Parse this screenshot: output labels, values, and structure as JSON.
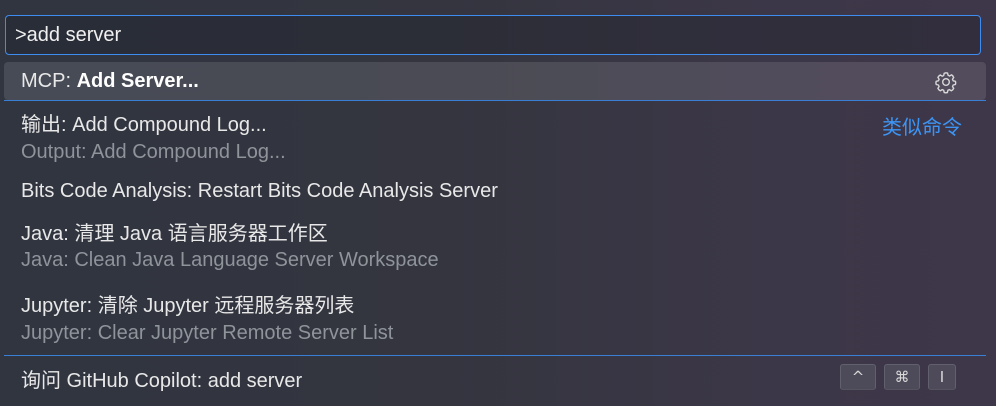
{
  "input": {
    "value": ">add server"
  },
  "items": [
    {
      "prefix": "MCP: ",
      "highlight": "Add Server...",
      "action": "gear-icon"
    },
    {
      "label": "输出: Add Compound Log...",
      "detail": "Output: Add Compound Log...",
      "tag": "类似命令"
    },
    {
      "label": "Bits Code Analysis: Restart Bits Code Analysis Server"
    },
    {
      "label": "Java: 清理 Java 语言服务器工作区",
      "detail": "Java: Clean Java Language Server Workspace"
    },
    {
      "label": "Jupyter: 清除 Jupyter 远程服务器列表",
      "detail": "Jupyter: Clear Jupyter Remote Server List"
    }
  ],
  "copilot": {
    "label": "询问 GitHub Copilot: add server",
    "keys": [
      "^",
      "⌘",
      "I"
    ]
  },
  "colors": {
    "accent": "#3f8cf0",
    "link": "#3c95f5"
  }
}
